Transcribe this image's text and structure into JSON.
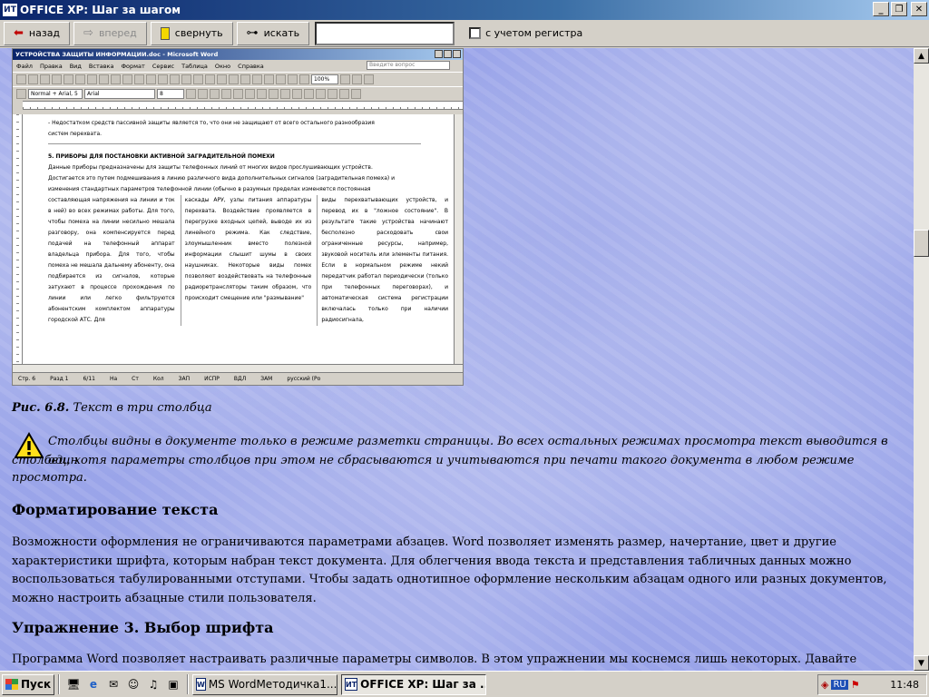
{
  "window": {
    "title": "OFFICE XP: Шаг за шагом",
    "app_icon": "ИТ",
    "controls": [
      "minimize-icon",
      "maximize-icon",
      "close-icon"
    ]
  },
  "toolbar": {
    "back_label": "назад",
    "forward_label": "вперед",
    "collapse_label": "свернуть",
    "search_label": "искать",
    "search_value": "",
    "case_label": "с учетом регистра"
  },
  "word_screenshot": {
    "title": "УСТРОЙСТВА ЗАЩИТЫ ИНФОРМАЦИИ.doc - Microsoft Word",
    "menu": [
      "Файл",
      "Правка",
      "Вид",
      "Вставка",
      "Формат",
      "Сервис",
      "Таблица",
      "Окно",
      "Справка"
    ],
    "ask_placeholder": "Введите вопрос",
    "zoom": "100%",
    "style": "Normal + Arial, 5",
    "font": "Arial",
    "size": "8",
    "line1": "- Недостатком средств пассивной защиты является то, что они не защищают от всего остального разнообразия",
    "line2": "систем перехвата.",
    "heading": "5. ПРИБОРЫ ДЛЯ ПОСТАНОВКИ АКТИВНОЙ ЗАГРАДИТЕЛЬНОЙ ПОМЕХИ",
    "intro1": "Данные приборы предназначены для защиты телефонных линий от многих видов прослушивающих устройств.",
    "intro2": "Достигается это путем подмешивания в линию различного вида дополнительных сигналов (заградительная помеха) и",
    "intro3": "изменения стандартных параметров телефонной линии (обычно в разумных пределах изменяется постоянная",
    "col1": "составляющая напряжения на линии и ток в ней) во всех режимах работы. Для того, чтобы помеха на линии несильно мешала разговору, она компенсируется перед подачей на телефонный аппарат владельца прибора. Для того, чтобы помеха не мешала дальнему абоненту, она подбирается из сигналов, которые затухают в процессе прохождения по линии или легко фильтруются абонентским комплектом аппаратуры городской АТС. Для",
    "col2": "каскады АРУ, узлы питания аппаратуры перехвата. Воздействие проявляется в перегрузке входных цепей, выводе их из линейного режима. Как следствие, злоумышленник вместо полезной информации слышит шумы в своих наушниках. Некоторые виды помех позволяют воздействовать на телефонные радиоретрансляторы таким образом, что происходит смещение или \"размывание\"",
    "col3": "виды перехватывающих устройств, и перевод их в \"ложное состояние\". В результате такие устройства начинают бесполезно расходовать свои ограниченные ресурсы, например, звуковой носитель или элементы питания. Если в нормальном режиме некий передатчик работал периодически (только при телефонных переговорах), и автоматическая система регистрации включалась только при наличии радиосигнала,",
    "status": [
      "Стр. 6",
      "Разд 1",
      "6/11",
      "На",
      "Ст",
      "Кол",
      "ЗАП",
      "ИСПР",
      "ВДЛ",
      "ЗАМ",
      "русский (Ро"
    ]
  },
  "content": {
    "caption_prefix": "Рис. 6.8.",
    "caption_text": "Текст в три столбца",
    "note_line1": "Столбцы видны в документе только в режиме разметки страницы. Во всех остальных режимах просмотра текст выводится в один",
    "note_line2": "столбец, хотя параметры столбцов при этом не сбрасываются и учитываются при печати такого документа в любом режиме",
    "note_line3": "просмотра.",
    "heading1": "Форматирование текста",
    "para1": "Возможности оформления не ограничиваются параметрами абзацев. Word позволяет изменять размер, начертание, цвет и другие характеристики шрифта, которым набран текст документа. Для облегчения ввода текста и представления табличных данных можно воспользоваться табулированными отступами. Чтобы задать однотипное оформление нескольким абзацам одного или разных документов, можно настроить абзацные стили пользователя.",
    "heading2": "Упражнение 3. Выбор шрифта",
    "para2": "Программа Word позволяет настраивать различные параметры символов. В этом упражнении мы коснемся лишь некоторых. Давайте"
  },
  "taskbar": {
    "start_label": "Пуск",
    "tasks": [
      {
        "label": "MS WordМетодичка1...",
        "active": false
      },
      {
        "label": "OFFICE XP: Шаг за ...",
        "active": true
      }
    ],
    "lang": "RU",
    "clock": "11:48"
  }
}
